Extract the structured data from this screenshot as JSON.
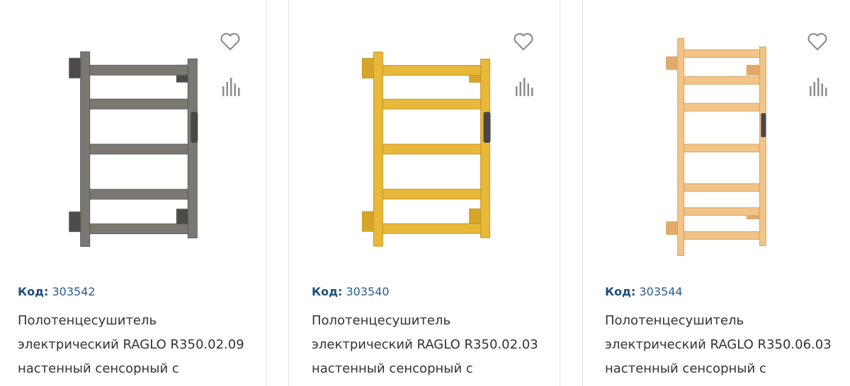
{
  "products": [
    {
      "code_label": "Код:",
      "code_value": "303542",
      "title_lines": [
        "Полотенцесушитель",
        "электрический RAGLO R350.02.09",
        "настенный сенсорный с"
      ],
      "finish_color": "#7b7874",
      "finish_dark": "#4a4846",
      "favorite_icon": "heart-icon",
      "compare_icon": "compare-bars-icon"
    },
    {
      "code_label": "Код:",
      "code_value": "303540",
      "title_lines": [
        "Полотенцесушитель",
        "электрический RAGLO R350.02.03",
        "настенный сенсорный с"
      ],
      "finish_color": "#e7b83a",
      "finish_dark": "#b8881a",
      "favorite_icon": "heart-icon",
      "compare_icon": "compare-bars-icon"
    },
    {
      "code_label": "Код:",
      "code_value": "303544",
      "title_lines": [
        "Полотенцесушитель",
        "электрический RAGLO R350.06.03",
        "настенный сенсорный с"
      ],
      "finish_color": "#f1c488",
      "finish_dark": "#d29a55",
      "favorite_icon": "heart-icon",
      "compare_icon": "compare-bars-icon"
    }
  ],
  "icon_color": "#8d8d8d"
}
